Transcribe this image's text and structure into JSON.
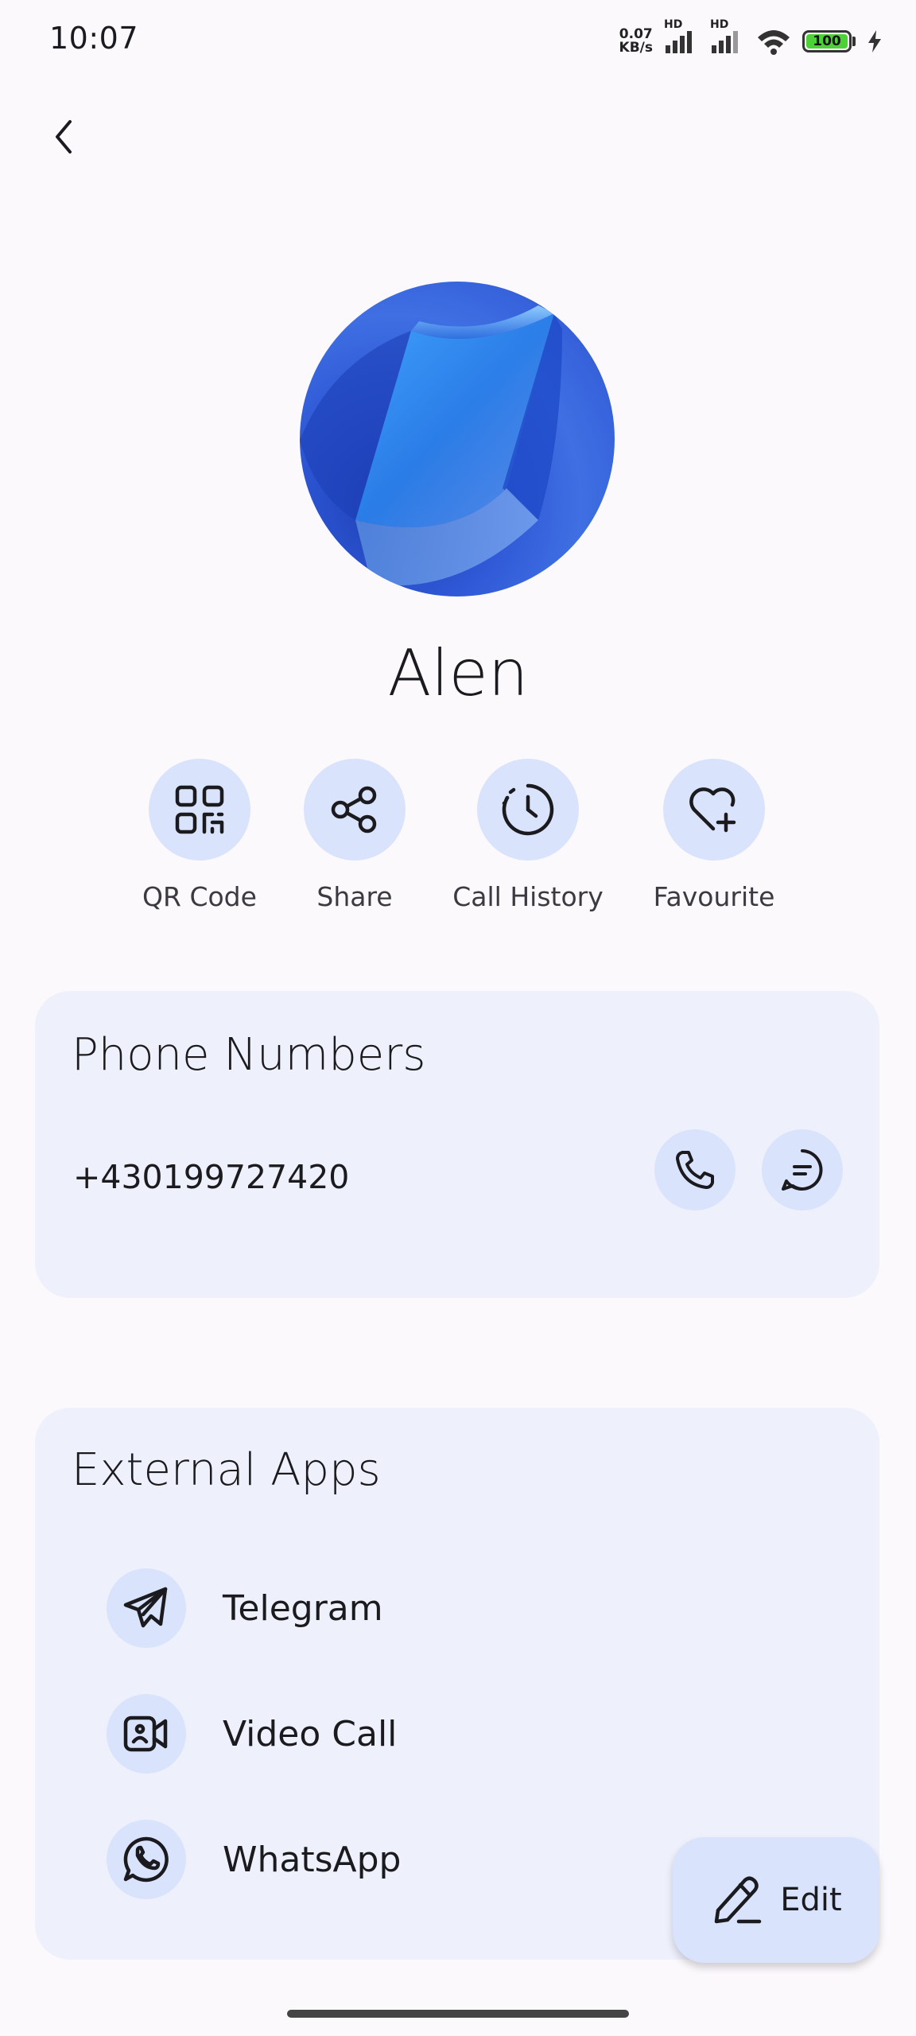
{
  "status_bar": {
    "time": "10:07",
    "net_speed_value": "0.07",
    "net_speed_unit": "KB/s",
    "signal_1_tag": "HD",
    "signal_2_tag": "HD",
    "battery_level": "100",
    "icons": [
      "signal-icon",
      "signal-icon",
      "wifi-icon",
      "battery-icon",
      "charging-icon"
    ]
  },
  "header": {
    "back_icon": "chevron-left-icon"
  },
  "contact": {
    "name": "Alen"
  },
  "quick_actions": [
    {
      "label": "QR Code",
      "icon": "qr-code-icon"
    },
    {
      "label": "Share",
      "icon": "share-icon"
    },
    {
      "label": "Call History",
      "icon": "history-icon"
    },
    {
      "label": "Favourite",
      "icon": "heart-plus-icon"
    }
  ],
  "phone_numbers": {
    "title": "Phone Numbers",
    "number": "+430199727420",
    "call_icon": "phone-icon",
    "message_icon": "message-icon"
  },
  "external_apps": {
    "title": "External Apps",
    "items": [
      {
        "label": "Telegram",
        "icon": "telegram-icon"
      },
      {
        "label": "Video Call",
        "icon": "video-call-icon"
      },
      {
        "label": "WhatsApp",
        "icon": "whatsapp-icon"
      }
    ]
  },
  "fab": {
    "label": "Edit",
    "icon": "pencil-icon"
  },
  "colors": {
    "background": "#fcf9fd",
    "card": "#eef1fc",
    "chip": "#d9e3fb",
    "battery": "#4cd137"
  }
}
